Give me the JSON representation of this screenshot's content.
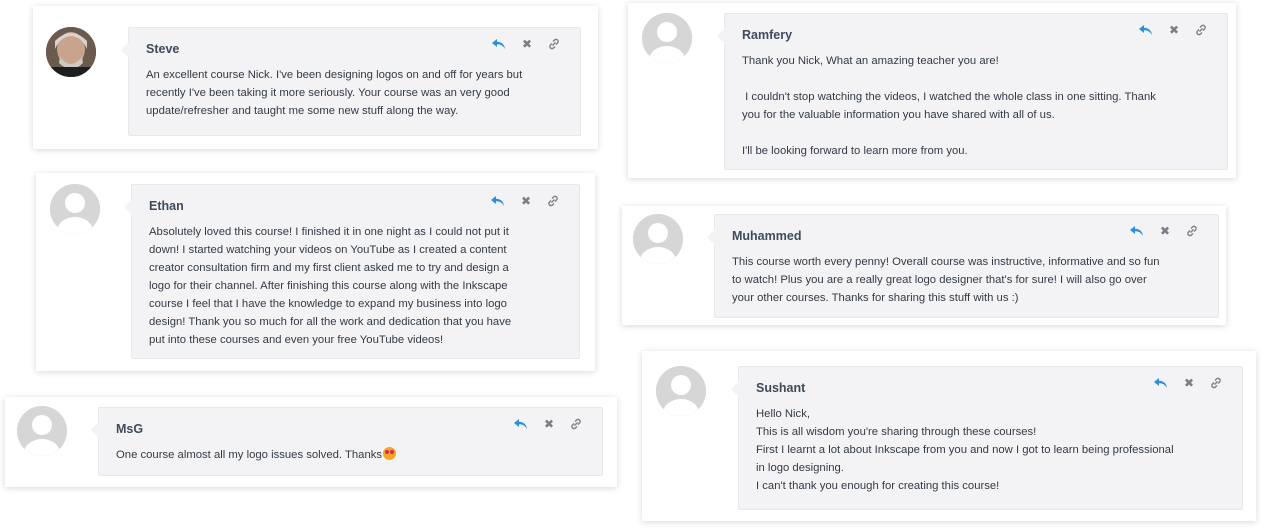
{
  "accent_color": "#2b8fd9",
  "icons": {
    "reply": "reply-icon",
    "delete": "close-icon",
    "link": "link-icon"
  },
  "comments": [
    {
      "author": "Steve",
      "avatar": "photo",
      "lines": [
        "An excellent course Nick. I've been designing logos on and off for years but",
        "recently I've been taking it more seriously. Your course was an very good",
        "update/refresher and taught me some new stuff along the way."
      ]
    },
    {
      "author": "Ethan",
      "avatar": "default",
      "lines": [
        "Absolutely loved this course! I finished it in one night as I could not put it",
        "down! I started watching your videos on YouTube as I created a content",
        "creator consultation firm and my first client asked me to try and design a",
        "logo for their channel. After finishing this course along with the Inkscape",
        "course I feel that I have the knowledge to expand my business into logo",
        "design! Thank you so much for all the work and dedication that you have",
        "put into these courses and even your free YouTube videos!"
      ]
    },
    {
      "author": "MsG",
      "avatar": "default",
      "lines": [
        "One course almost all my logo issues solved. Thanks"
      ],
      "emoji": "heart-eyes-emoji"
    },
    {
      "author": "Ramfery",
      "avatar": "default",
      "lines": [
        "Thank you Nick, What an amazing teacher you are!",
        "",
        " I couldn't stop watching the videos, I watched the whole class in one sitting. Thank",
        "you for the valuable information you have shared with all of us.",
        "",
        "I'll be looking forward to learn more from you."
      ]
    },
    {
      "author": "Muhammed",
      "avatar": "default",
      "lines": [
        "This course worth every penny! Overall course was instructive, informative and so fun",
        "to watch! Plus you are a really great logo designer that's for sure! I will also go over",
        "your other courses. Thanks for sharing this stuff with us :)"
      ]
    },
    {
      "author": "Sushant",
      "avatar": "default",
      "lines": [
        "Hello Nick,",
        "This is all wisdom you're sharing through these courses!",
        "First I learnt a lot about Inkscape from you and now I got to learn being professional",
        "in logo designing.",
        "I can't thank you enough for creating this course!"
      ]
    }
  ]
}
